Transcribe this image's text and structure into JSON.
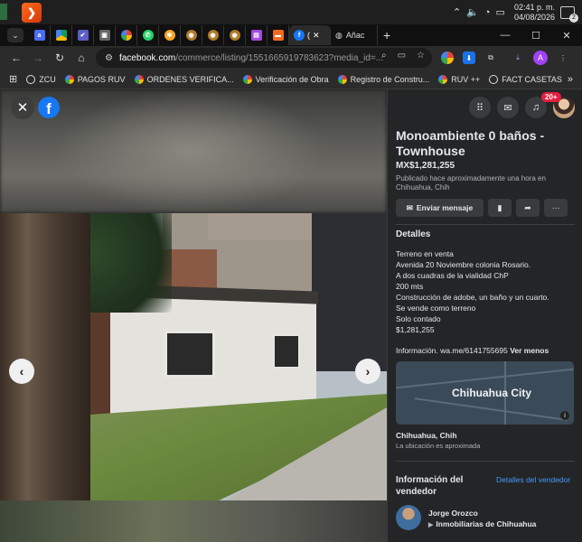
{
  "taskbar": {
    "time": "02:41 p. m.",
    "date": "04/08/2026",
    "notifications": "2"
  },
  "tabs": {
    "active_title": "(",
    "other_title": "Añac",
    "new_tab": "+"
  },
  "window": {
    "minimize": "—",
    "maximize": "☐",
    "close": "✕"
  },
  "address_bar": {
    "host": "facebook.com",
    "path": "/commerce/listing/1551665919783623?media_id=..."
  },
  "profile_initial": "A",
  "bookmarks": [
    {
      "label": "ZCU",
      "icon": "globe-icon"
    },
    {
      "label": "PAGOS RUV",
      "icon": "chrome-icon"
    },
    {
      "label": "ORDENES VERIFICA...",
      "icon": "chrome-icon"
    },
    {
      "label": "Verificación de Obra",
      "icon": "chrome-icon"
    },
    {
      "label": "Registro de Constru...",
      "icon": "chrome-icon"
    },
    {
      "label": "RUV ++",
      "icon": "chrome-icon"
    },
    {
      "label": "FACT CASETAS",
      "icon": "globe-icon"
    }
  ],
  "bookmarks_more": "»",
  "viewer": {
    "close_glyph": "✕",
    "logo_letter": "f",
    "prev_glyph": "‹",
    "next_glyph": "›"
  },
  "header_icons": {
    "notifications_badge": "20+"
  },
  "listing": {
    "title": "Monoambiente 0 baños - Townhouse",
    "price": "MX$1,281,255",
    "posted": "Publicado hace aproximadamente una hora en Chihuahua, Chih",
    "message_button": "Enviar mensaje",
    "details_heading": "Detalles",
    "details_lines": [
      "Terreno en venta",
      "Avenida 20  Noviembre colonia Rosario.",
      "A dos cuadras de la vialidad ChP",
      "200 mts",
      "Construcción de adobe, un baño y un cuarto.",
      "Se vende como terreno",
      "Solo contado",
      "$1,281,255"
    ],
    "info_text": "Información. wa.me/6141755695",
    "info_toggle": "Ver menos",
    "map_label": "Chihuahua City",
    "location": "Chihuahua, Chih",
    "location_note": "La ubicación es aproximada",
    "seller_heading": "Información del vendedor",
    "seller_link": "Detalles del vendedor",
    "seller_name": "Jorge Orozco",
    "seller_company": "Inmobiliarias de Chihuahua"
  }
}
